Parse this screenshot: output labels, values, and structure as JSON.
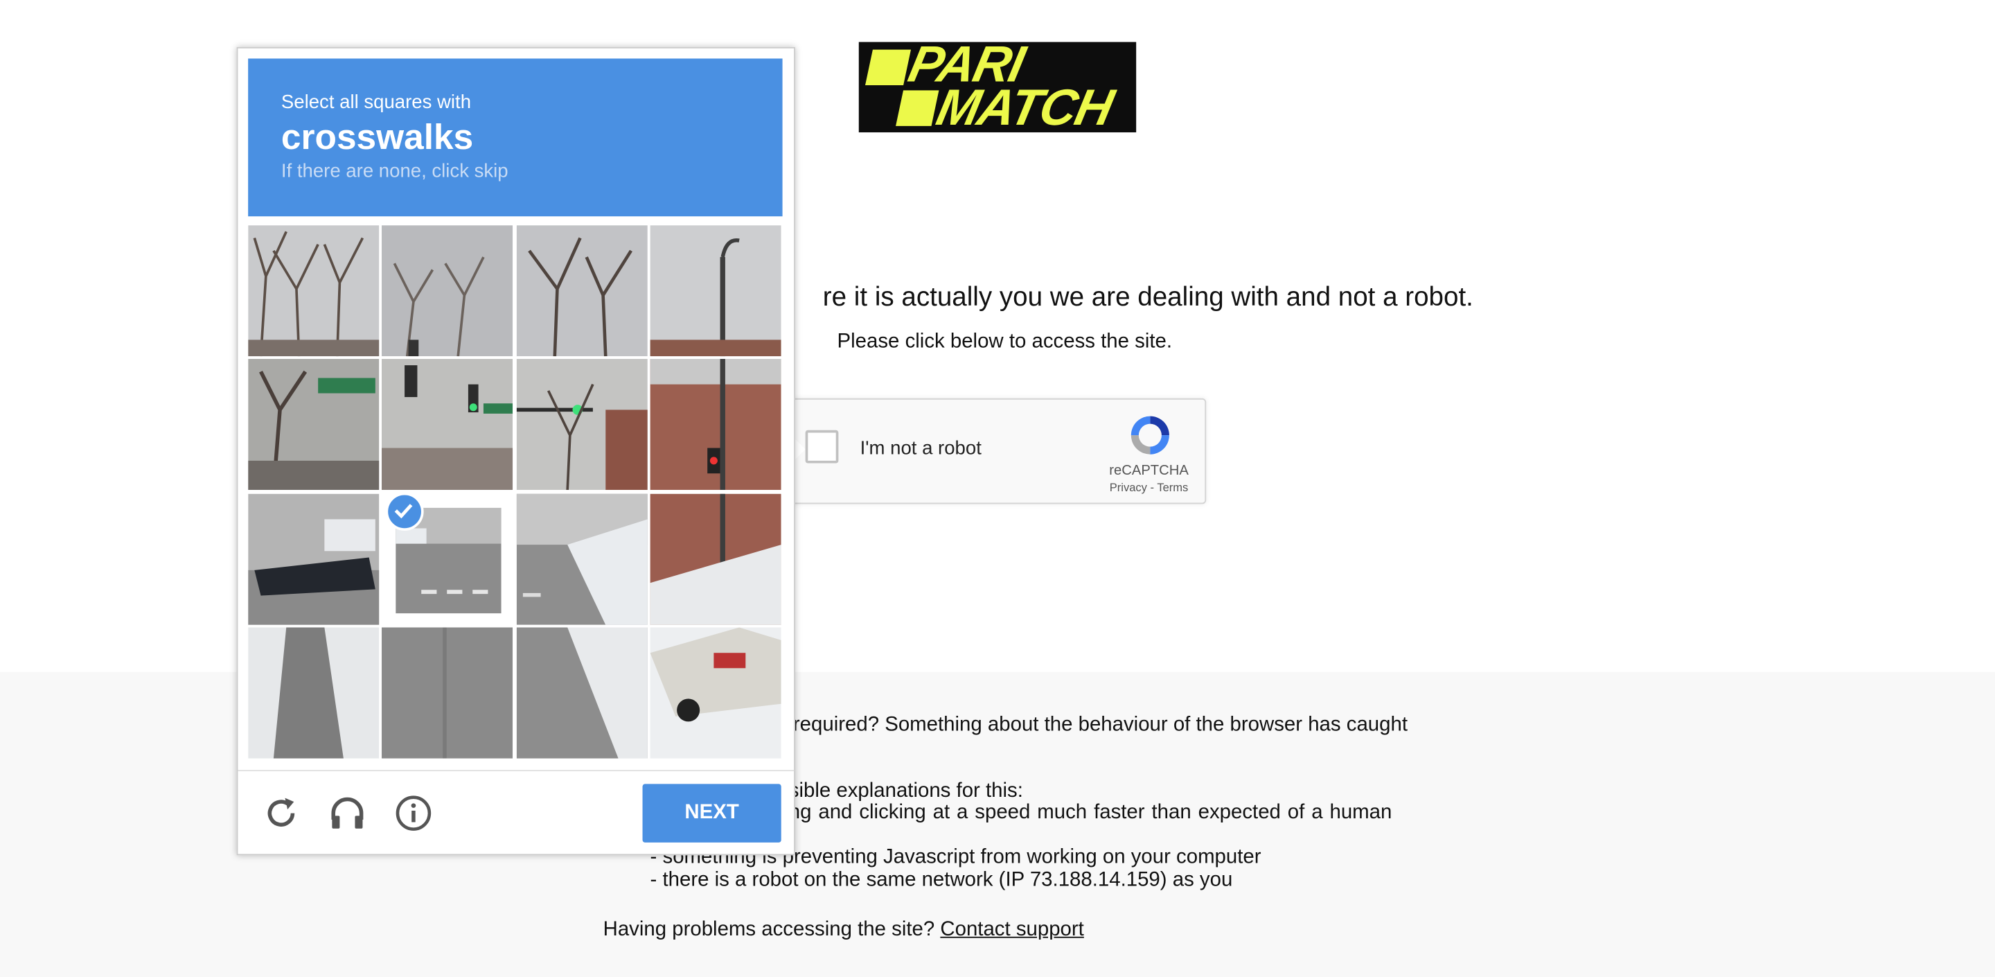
{
  "logo": {
    "line1": "PARI",
    "line2": "MATCH",
    "background": "#0d0d0d",
    "color": "#ecf94a"
  },
  "main": {
    "headline": "re it is actually you we are dealing with and not a robot.",
    "subline": "Please click below to access the site."
  },
  "recaptcha": {
    "label": "I'm not a robot",
    "brand": "reCAPTCHA",
    "links": "Privacy - Terms",
    "logo_icon": "recaptcha-logo-icon"
  },
  "info": {
    "why": "n required? Something about the behaviour of the browser has caught",
    "explanations": "sible explanations for this:",
    "reason1": "ng and clicking at a speed much faster than expected of a human",
    "reason2": "- something is preventing Javascript from working on your computer",
    "reason3": "- there is a robot on the same network (IP 73.188.14.159) as you",
    "help": "Having problems accessing the site? ",
    "contact": "Contact support"
  },
  "challenge": {
    "line1": "Select all squares with",
    "keyword": "crosswalks",
    "line3": "If there are none, click skip",
    "header_color": "#4a90e2",
    "next_label": "NEXT",
    "selected_tile": 9,
    "icons": [
      "reload-icon",
      "audio-icon",
      "info-icon"
    ]
  }
}
